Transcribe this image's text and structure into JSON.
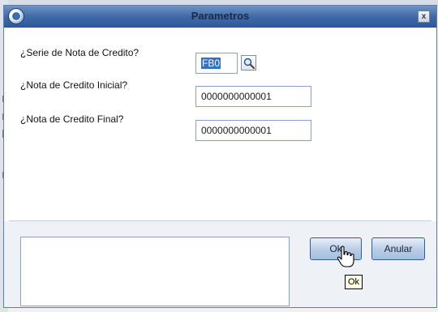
{
  "dialog": {
    "title": "Parametros",
    "close_label": "x"
  },
  "form": {
    "fields": [
      {
        "label": "¿Serie de Nota de Credito?",
        "value": "FB0"
      },
      {
        "label": "¿Nota de Credito Inicial?",
        "value": "0000000000001"
      },
      {
        "label": "¿Nota de Credito Final?",
        "value": "0000000000001"
      }
    ]
  },
  "buttons": {
    "ok_label": "Ok",
    "cancel_label": "Anular"
  },
  "tooltip": {
    "text": "Ok"
  },
  "colors": {
    "titlebar": "#3e68a6",
    "selection": "#3370c6",
    "footer_bg": "#eef1f6"
  }
}
